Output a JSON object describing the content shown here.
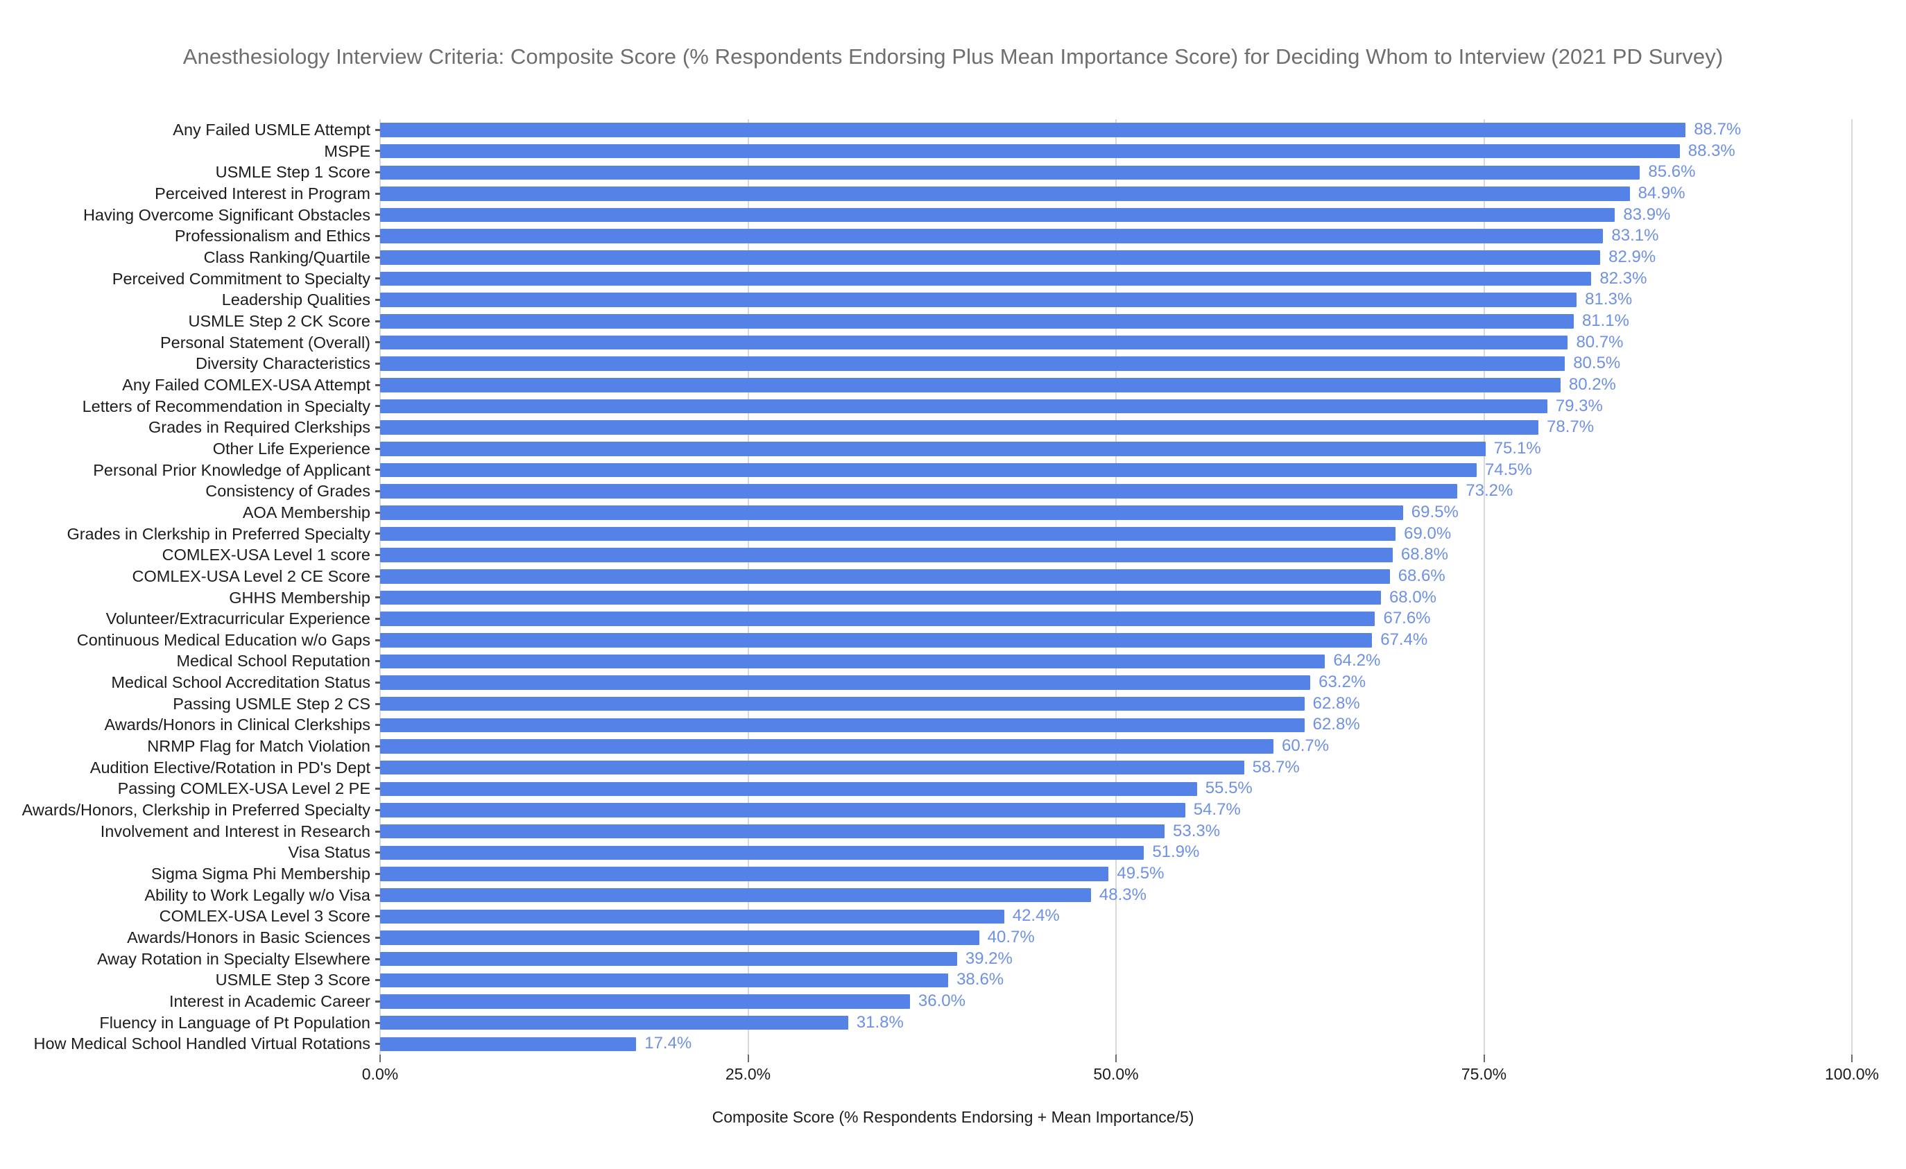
{
  "chart_data": {
    "type": "bar",
    "orientation": "horizontal",
    "title": "Anesthesiology Interview Criteria: Composite Score (% Respondents Endorsing Plus Mean Importance Score) for Deciding Whom to Interview (2021 PD Survey)",
    "xlabel": "Composite Score (% Respondents Endorsing + Mean Importance/5)",
    "ylabel": "",
    "xlim": [
      0,
      100
    ],
    "xticks": [
      0,
      25,
      50,
      75,
      100
    ],
    "xtick_labels": [
      "0.0%",
      "25.0%",
      "50.0%",
      "75.0%",
      "100.0%"
    ],
    "grid": true,
    "legend": "none",
    "bar_color": "#5482e6",
    "value_label_color": "#6f91e4",
    "title_color": "#6e6e6e",
    "value_label_suffix": "%",
    "categories": [
      "Any Failed USMLE Attempt",
      "MSPE",
      "USMLE Step 1 Score",
      "Perceived Interest in Program",
      "Having Overcome Significant Obstacles",
      "Professionalism and Ethics",
      "Class Ranking/Quartile",
      "Perceived Commitment to Specialty",
      "Leadership Qualities",
      "USMLE Step 2 CK Score",
      "Personal Statement (Overall)",
      "Diversity Characteristics",
      "Any Failed COMLEX-USA Attempt",
      "Letters of Recommendation in Specialty",
      "Grades in Required Clerkships",
      "Other Life Experience",
      "Personal Prior Knowledge of Applicant",
      "Consistency of Grades",
      "AOA Membership",
      "Grades in Clerkship in Preferred Specialty",
      "COMLEX-USA Level 1 score",
      "COMLEX-USA Level 2 CE Score",
      "GHHS Membership",
      "Volunteer/Extracurricular Experience",
      "Continuous Medical Education w/o Gaps",
      "Medical School Reputation",
      "Medical School Accreditation Status",
      "Passing USMLE Step 2 CS",
      "Awards/Honors in Clinical Clerkships",
      "NRMP Flag for Match Violation",
      "Audition Elective/Rotation in PD's Dept",
      "Passing COMLEX-USA Level 2 PE",
      "Awards/Honors, Clerkship in Preferred Specialty",
      "Involvement and Interest in Research",
      "Visa Status",
      "Sigma Sigma Phi Membership",
      "Ability to Work Legally w/o Visa",
      "COMLEX-USA Level 3 Score",
      "Awards/Honors in Basic Sciences",
      "Away Rotation in Specialty Elsewhere",
      "USMLE Step 3 Score",
      "Interest in Academic Career",
      "Fluency in Language of Pt Population",
      "How Medical School Handled Virtual Rotations"
    ],
    "values": [
      88.7,
      88.3,
      85.6,
      84.9,
      83.9,
      83.1,
      82.9,
      82.3,
      81.3,
      81.1,
      80.7,
      80.5,
      80.2,
      79.3,
      78.7,
      75.1,
      74.5,
      73.2,
      69.5,
      69.0,
      68.8,
      68.6,
      68.0,
      67.6,
      67.4,
      64.2,
      63.2,
      62.8,
      62.8,
      60.7,
      58.7,
      55.5,
      54.7,
      53.3,
      51.9,
      49.5,
      48.3,
      42.4,
      40.7,
      39.2,
      38.6,
      36.0,
      31.8,
      17.4
    ],
    "value_labels": [
      "88.7%",
      "88.3%",
      "85.6%",
      "84.9%",
      "83.9%",
      "83.1%",
      "82.9%",
      "82.3%",
      "81.3%",
      "81.1%",
      "80.7%",
      "80.5%",
      "80.2%",
      "79.3%",
      "78.7%",
      "75.1%",
      "74.5%",
      "73.2%",
      "69.5%",
      "69.0%",
      "68.8%",
      "68.6%",
      "68.0%",
      "67.6%",
      "67.4%",
      "64.2%",
      "63.2%",
      "62.8%",
      "62.8%",
      "60.7%",
      "58.7%",
      "55.5%",
      "54.7%",
      "53.3%",
      "51.9%",
      "49.5%",
      "48.3%",
      "42.4%",
      "40.7%",
      "39.2%",
      "38.6%",
      "36.0%",
      "31.8%",
      "17.4%"
    ]
  }
}
